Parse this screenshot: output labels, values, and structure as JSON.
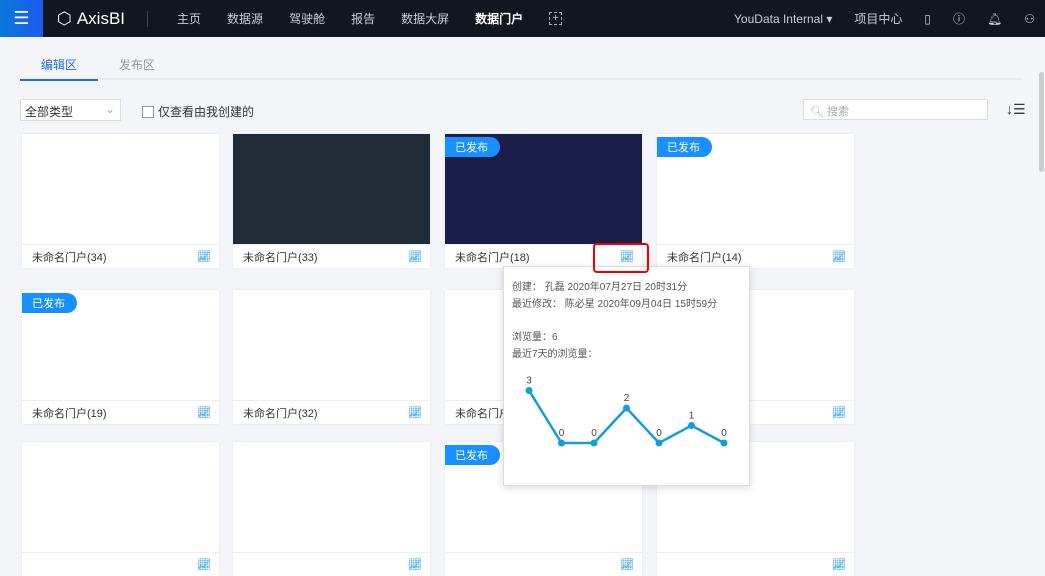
{
  "nav": {
    "brand": "AxisBI",
    "items": [
      "主页",
      "数据源",
      "驾驶舱",
      "报告",
      "数据大屏",
      "数据门户"
    ],
    "active": 5,
    "workspace": "YouData Internal",
    "project_center": "项目中心"
  },
  "tabs": [
    "编辑区",
    "发布区"
  ],
  "filters": {
    "type_select": "全部类型",
    "mine_only": "仅查看由我创建的",
    "search_placeholder": "搜索"
  },
  "published_label": "已发布",
  "cards": [
    {
      "name": "未命名门户(34)",
      "published": false,
      "thumb": "white"
    },
    {
      "name": "未命名门户(33)",
      "published": false,
      "thumb": "dash"
    },
    {
      "name": "未命名门户(18)",
      "published": true,
      "thumb": "dark"
    },
    {
      "name": "未命名门户(14)",
      "published": true,
      "thumb": "white"
    },
    {
      "name": "未命名门户(19)",
      "published": true,
      "thumb": "white"
    },
    {
      "name": "未命名门户(32)",
      "published": false,
      "thumb": "white"
    },
    {
      "name": "未命名门户(",
      "published": false,
      "thumb": "white"
    },
    {
      "name": "",
      "published": false,
      "thumb": "white"
    },
    {
      "name": "",
      "published": false,
      "thumb": "white"
    },
    {
      "name": "",
      "published": false,
      "thumb": "white"
    },
    {
      "name": "",
      "published": true,
      "thumb": "white"
    },
    {
      "name": "",
      "published": false,
      "thumb": "white"
    }
  ],
  "tooltip": {
    "created": "创建： 孔磊  2020年07月27日 20时31分",
    "modified": "最近修改： 陈必星  2020年09月04日 15时59分",
    "views": "浏览量：6",
    "recent_label": "最近7天的浏览量："
  },
  "chart_data": {
    "type": "line",
    "title": "最近7天的浏览量",
    "x": [
      1,
      2,
      3,
      4,
      5,
      6,
      7
    ],
    "values": [
      3,
      0,
      0,
      2,
      0,
      1,
      0
    ],
    "color": "#139fd6"
  }
}
